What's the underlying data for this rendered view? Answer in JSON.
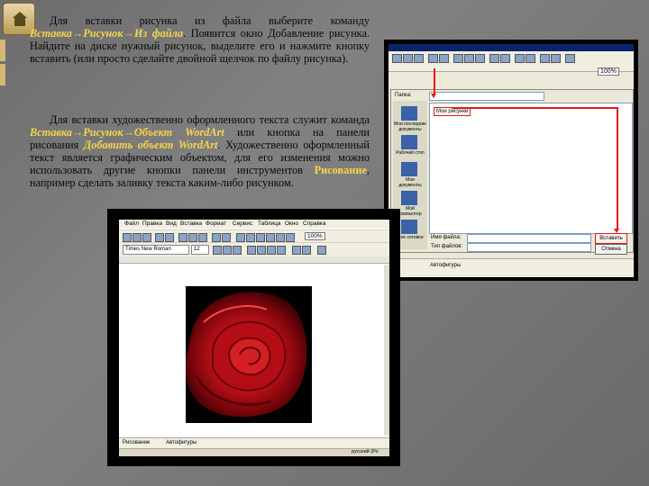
{
  "paragraph1": {
    "pre": "Для вставки рисунка из файла выберите команду ",
    "command": "Вставка→Рисунок→Из файла",
    "post": ". Появится окно Добавление рисунка. Найдите на диске нужный рисунок, выделите его и нажмите кнопку вставить (или просто сделайте двойной щелчок по файлу рисунка)."
  },
  "paragraph2": {
    "t1": "Для вставки художественно оформленного текста служит команда ",
    "cmd": "Вставка→Рисунок→Объект WordArt",
    "t2": " или кнопка на панели рисования ",
    "btn": "Добавить объект WordArt",
    "t3": ". Художественно оформленный текст является графическим объектом, для его изменения можно использовать другие кнопки панели инструментов ",
    "panel": "Рисование",
    "t4": ", например сделать заливку текста каким-либо рисунком."
  },
  "dialog_shot": {
    "zoom": "100%",
    "folder_label": "Папка:",
    "folder_item": "Мои рисунки",
    "sidebar": [
      "Мои последние документы",
      "Рабочий стол",
      "Мои документы",
      "Мой компьютер",
      "Мое сетевое"
    ],
    "filename_label": "Имя файла:",
    "filetype_label": "Тип файлов:",
    "insert_button": "Вставить",
    "cancel_button": "Отмена",
    "autoshapes": "Автофигуры"
  },
  "word_shot": {
    "menu": [
      "Файл",
      "Правка",
      "Вид",
      "Вставка",
      "Формат",
      "Сервис",
      "Таблица",
      "Окно",
      "Справка"
    ],
    "font": "Times New Roman",
    "size": "12",
    "zoom": "100%",
    "draw_label": "Рисование",
    "autoshapes": "Автофигуры",
    "status_lang": "русский (Ро"
  },
  "colors": {
    "accent": "#f4d54a",
    "highlight": "#e41818"
  }
}
